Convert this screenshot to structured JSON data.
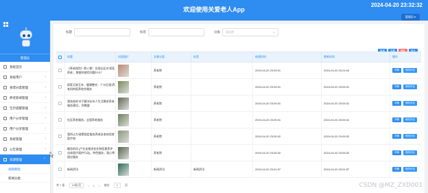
{
  "header": {
    "title": "欢迎使用关爱老人App",
    "datetime": "2024-04-20 23:32:32",
    "admin_button": "管理员 ▾"
  },
  "sidebar": {
    "role": "管理员",
    "items": [
      {
        "label": "系统首页",
        "icon": "home-icon",
        "has_arrow": false,
        "active": false
      },
      {
        "label": "系统用户",
        "icon": "user-icon",
        "has_arrow": true,
        "active": false
      },
      {
        "label": "食谱分类管理",
        "icon": "folder-icon",
        "has_arrow": true,
        "active": false
      },
      {
        "label": "养老新闻管理",
        "icon": "news-icon",
        "has_arrow": true,
        "active": false
      },
      {
        "label": "告示提醒管理",
        "icon": "bell-icon",
        "has_arrow": true,
        "active": false
      },
      {
        "label": "用户分享管理",
        "icon": "share-icon",
        "has_arrow": true,
        "active": false
      },
      {
        "label": "用户分享管理",
        "icon": "share-icon",
        "has_arrow": true,
        "active": false
      },
      {
        "label": "系统管理",
        "icon": "gear-icon",
        "has_arrow": true,
        "active": false
      },
      {
        "label": "公告管理",
        "icon": "notice-icon",
        "has_arrow": true,
        "active": false
      },
      {
        "label": "资源管理",
        "icon": "resource-icon",
        "has_arrow": true,
        "active": true
      }
    ],
    "subitems": [
      "视频教程",
      "新闻分类"
    ]
  },
  "search": {
    "label1": "标题",
    "label2": "标签",
    "label3": "分类",
    "placeholder3": "请选择"
  },
  "actions": [
    {
      "label": "新增",
      "color": "#2f8cf0"
    },
    {
      "label": "查看",
      "color": "#2f8cf0"
    },
    {
      "label": "删除",
      "color": "#f56c6c"
    },
    {
      "label": "统计",
      "color": "#2f8cf0"
    }
  ],
  "table": {
    "headers": [
      "标题",
      "封面图片",
      "文章分类",
      "标签",
      "新建时间",
      "更新时间",
      "操作"
    ],
    "rows": [
      {
        "title": "《养老保险》第17期：实现社区对'家医养老'，数据的使用问题什么？",
        "img_color": "#b98a6f",
        "category": "养老院",
        "tag": "",
        "created": "2024-04-20 23:05:31",
        "updated": "2024-04-20 23:24:04"
      },
      {
        "title": "探索互联互补、健康整合：'广州日报'养老机构医养结合服务",
        "img_color": "#7b8a5a",
        "category": "养老院",
        "tag": "",
        "created": "2024-04-20 23:05:31",
        "updated": "2024-04-20 23:05:31"
      },
      {
        "title": "我爸爸的'对子解决长年人生活需求养老服务建设'，你需要",
        "img_color": "#5f6b55",
        "category": "养老院",
        "tag": "",
        "created": "2024-04-20 23:05:31",
        "updated": "2024-04-20 23:05:31"
      },
      {
        "title": "社区养老服务，全国养老服务",
        "img_color": "#6d7f5c",
        "category": "养老院",
        "tag": "",
        "created": "2024-04-20 23:05:31",
        "updated": "2024-04-20 23:05:31"
      },
      {
        "title": "我所认为'政策规定服务养老金老体验就医疗效'",
        "img_color": "#8a9a7a",
        "category": "养老院",
        "tag": "",
        "created": "2024-04-20 23:05:32",
        "updated": "2024-04-20 23:05:32"
      },
      {
        "title": "蝶恋的风 [产业化推进化在和医意养护化体医疗观护行动]，特色服务，我心将接应服务",
        "img_color": "#56664e",
        "category": "养老院",
        "tag": "",
        "created": "2024-04-20 23:05:32",
        "updated": "2024-04-20 23:05:32"
      },
      {
        "title": "新闻资讯",
        "img_color": "#2c6b52",
        "category": "新闻资讯",
        "tag": "新闻资讯",
        "created": "2024-04-20 23:01:57",
        "updated": "2024-04-20 23:01:57"
      }
    ],
    "row_buttons": [
      "详情",
      "修改评论"
    ]
  },
  "pager": {
    "total": "共 7 条",
    "page_size": "10条/页",
    "prev": "‹",
    "current": "1",
    "next": "›",
    "goto_label": "前往",
    "goto_value": "1",
    "page_suffix": "页"
  },
  "watermark": "CSDN @MZ_ZXD001"
}
